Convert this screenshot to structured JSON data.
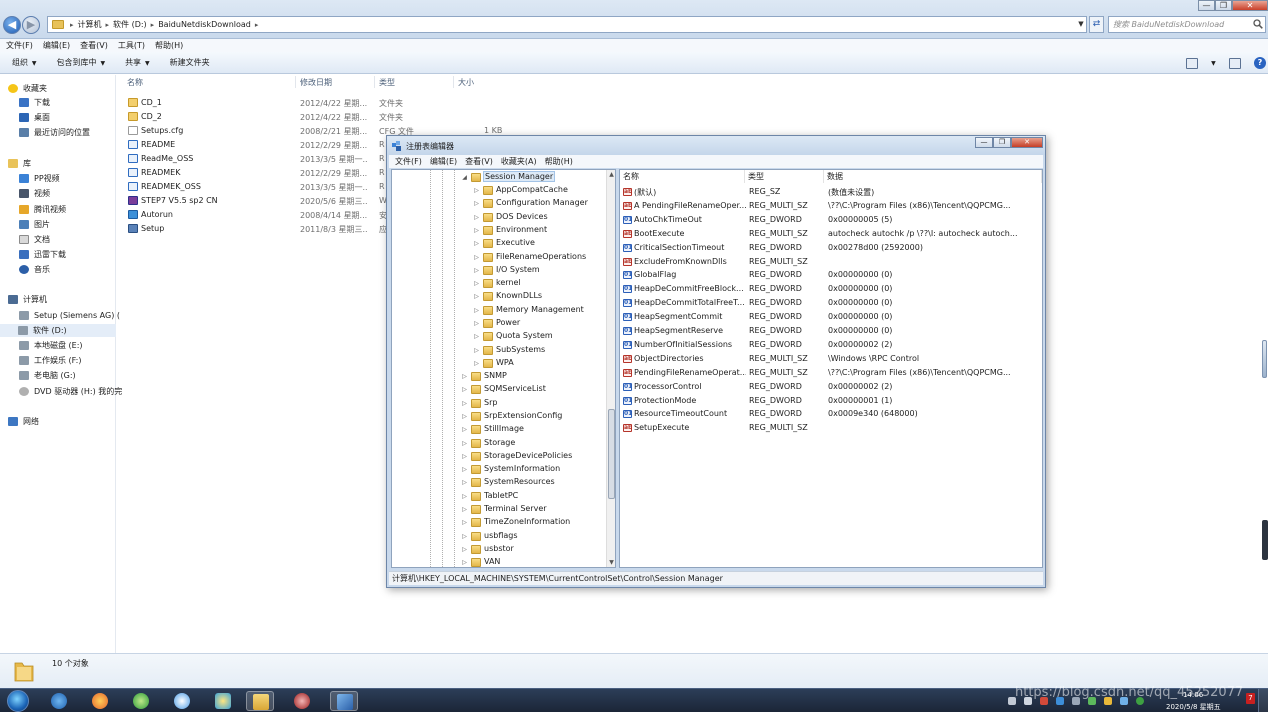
{
  "explorer": {
    "address_crumbs": [
      "计算机",
      "软件 (D:)",
      "BaiduNetdiskDownload"
    ],
    "search_placeholder": "搜索 BaiduNetdiskDownload",
    "menu": [
      "文件(F)",
      "编辑(E)",
      "查看(V)",
      "工具(T)",
      "帮助(H)"
    ],
    "toolbar": [
      "组织",
      "包含到库中",
      "共享",
      "新建文件夹"
    ],
    "nav": {
      "favorites_header": "收藏夹",
      "favorites": [
        "下载",
        "桌面",
        "最近访问的位置"
      ],
      "library_header": "库",
      "libraries": [
        "PP视频",
        "视频",
        "腾讯视频",
        "图片",
        "文档",
        "迅雷下载",
        "音乐"
      ],
      "computer_header": "计算机",
      "drives": [
        "Setup (Siemens AG) (",
        "软件 (D:)",
        "本地磁盘 (E:)",
        "工作娱乐 (F:)",
        "老电脑 (G:)",
        "DVD 驱动器 (H:) 我的完"
      ],
      "network_header": "网络"
    },
    "columns": [
      "名称",
      "修改日期",
      "类型",
      "大小"
    ],
    "files": [
      {
        "name": "CD_1",
        "date": "2012/4/22 星期...",
        "type": "文件夹",
        "size": "",
        "icon": "folder-icon"
      },
      {
        "name": "CD_2",
        "date": "2012/4/22 星期...",
        "type": "文件夹",
        "size": "",
        "icon": "folder-icon"
      },
      {
        "name": "Setups.cfg",
        "date": "2008/2/21 星期...",
        "type": "CFG 文件",
        "size": "1 KB",
        "icon": "file-icon"
      },
      {
        "name": "README",
        "date": "2012/2/29 星期...",
        "type": "R",
        "size": "",
        "icon": "html-icon"
      },
      {
        "name": "ReadMe_OSS",
        "date": "2013/3/5 星期一...",
        "type": "R",
        "size": "",
        "icon": "html-icon"
      },
      {
        "name": "READMEK",
        "date": "2012/2/29 星期...",
        "type": "R",
        "size": "",
        "icon": "html-icon"
      },
      {
        "name": "READMEK_OSS",
        "date": "2013/3/5 星期一...",
        "type": "R",
        "size": "",
        "icon": "html-icon"
      },
      {
        "name": "STEP7 V5.5 sp2 CN",
        "date": "2020/5/6 星期三...",
        "type": "W",
        "size": "",
        "icon": "winrar-icon"
      },
      {
        "name": "Autorun",
        "date": "2008/4/14 星期...",
        "type": "安",
        "size": "",
        "icon": "autorun-icon"
      },
      {
        "name": "Setup",
        "date": "2011/8/3 星期三...",
        "type": "应",
        "size": "",
        "icon": "setup-icon"
      }
    ],
    "item_count": "10 个对象"
  },
  "regedit": {
    "title": "注册表编辑器",
    "menu": [
      "文件(F)",
      "编辑(E)",
      "查看(V)",
      "收藏夹(A)",
      "帮助(H)"
    ],
    "tree_selected": "Session Manager",
    "tree_children": [
      "AppCompatCache",
      "Configuration Manager",
      "DOS Devices",
      "Environment",
      "Executive",
      "FileRenameOperations",
      "I/O System",
      "kernel",
      "KnownDLLs",
      "Memory Management",
      "Power",
      "Quota System",
      "SubSystems",
      "WPA"
    ],
    "tree_siblings": [
      "SNMP",
      "SQMServiceList",
      "Srp",
      "SrpExtensionConfig",
      "StillImage",
      "Storage",
      "StorageDevicePolicies",
      "SystemInformation",
      "SystemResources",
      "TabletPC",
      "Terminal Server",
      "TimeZoneInformation",
      "usbflags",
      "usbstor",
      "VAN"
    ],
    "columns": [
      "名称",
      "类型",
      "数据"
    ],
    "values": [
      {
        "name": "(默认)",
        "type": "REG_SZ",
        "data": "(数值未设置)",
        "kind": "sz"
      },
      {
        "name": "A PendingFileRenameOper...",
        "type": "REG_MULTI_SZ",
        "data": "\\??\\C:\\Program Files (x86)\\Tencent\\QQPCMG...",
        "kind": "sz"
      },
      {
        "name": "AutoChkTimeOut",
        "type": "REG_DWORD",
        "data": "0x00000005 (5)",
        "kind": "dw"
      },
      {
        "name": "BootExecute",
        "type": "REG_MULTI_SZ",
        "data": "autocheck autochk /p \\??\\I: autocheck autoch...",
        "kind": "sz"
      },
      {
        "name": "CriticalSectionTimeout",
        "type": "REG_DWORD",
        "data": "0x00278d00 (2592000)",
        "kind": "dw"
      },
      {
        "name": "ExcludeFromKnownDlls",
        "type": "REG_MULTI_SZ",
        "data": "",
        "kind": "sz"
      },
      {
        "name": "GlobalFlag",
        "type": "REG_DWORD",
        "data": "0x00000000 (0)",
        "kind": "dw"
      },
      {
        "name": "HeapDeCommitFreeBlock...",
        "type": "REG_DWORD",
        "data": "0x00000000 (0)",
        "kind": "dw"
      },
      {
        "name": "HeapDeCommitTotalFreeT...",
        "type": "REG_DWORD",
        "data": "0x00000000 (0)",
        "kind": "dw"
      },
      {
        "name": "HeapSegmentCommit",
        "type": "REG_DWORD",
        "data": "0x00000000 (0)",
        "kind": "dw"
      },
      {
        "name": "HeapSegmentReserve",
        "type": "REG_DWORD",
        "data": "0x00000000 (0)",
        "kind": "dw"
      },
      {
        "name": "NumberOfInitialSessions",
        "type": "REG_DWORD",
        "data": "0x00000002 (2)",
        "kind": "dw"
      },
      {
        "name": "ObjectDirectories",
        "type": "REG_MULTI_SZ",
        "data": "\\Windows \\RPC Control",
        "kind": "sz"
      },
      {
        "name": "PendingFileRenameOperat...",
        "type": "REG_MULTI_SZ",
        "data": "\\??\\C:\\Program Files (x86)\\Tencent\\QQPCMG...",
        "kind": "sz"
      },
      {
        "name": "ProcessorControl",
        "type": "REG_DWORD",
        "data": "0x00000002 (2)",
        "kind": "dw"
      },
      {
        "name": "ProtectionMode",
        "type": "REG_DWORD",
        "data": "0x00000001 (1)",
        "kind": "dw"
      },
      {
        "name": "ResourceTimeoutCount",
        "type": "REG_DWORD",
        "data": "0x0009e340 (648000)",
        "kind": "dw"
      },
      {
        "name": "SetupExecute",
        "type": "REG_MULTI_SZ",
        "data": "",
        "kind": "sz"
      }
    ],
    "status_path": "计算机\\HKEY_LOCAL_MACHINE\\SYSTEM\\CurrentControlSet\\Control\\Session Manager"
  },
  "taskbar": {
    "time": "14:06",
    "date": "2020/5/8 星期五",
    "watermark": "https://blog.csdn.net/qq_45252077",
    "badge": "7"
  }
}
